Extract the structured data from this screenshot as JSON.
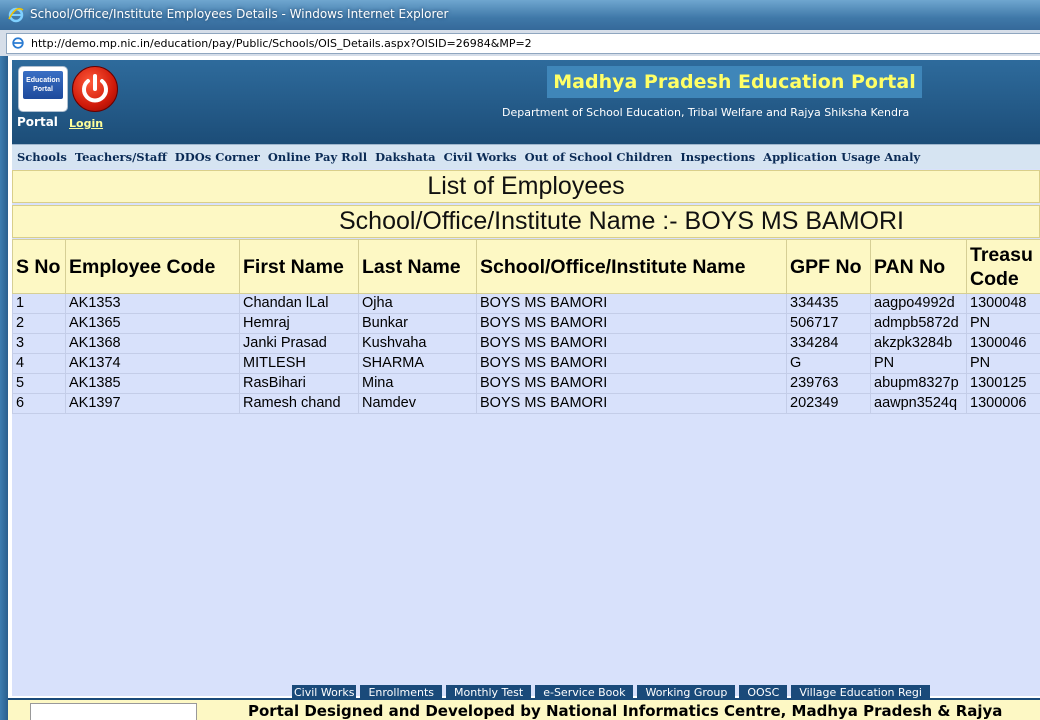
{
  "window": {
    "title": "School/Office/Institute Employees Details - Windows Internet Explorer",
    "url": "http://demo.mp.nic.in/education/pay/Public/Schools/OIS_Details.aspx?OISID=26984&MP=2"
  },
  "header": {
    "logo_text": "Education Portal",
    "portal_label": "Portal",
    "login_label": "Login",
    "site_title": "Madhya Pradesh Education Portal",
    "department": "Department of School Education, Tribal Welfare and Rajya Shiksha Kendra"
  },
  "nav": [
    "Schools",
    "Teachers/Staff",
    "DDOs Corner",
    "Online Pay Roll",
    "Dakshata",
    "Civil Works",
    "Out of School Children",
    "Inspections",
    "Application Usage Analy"
  ],
  "page": {
    "heading": "List of Employees",
    "school_line": "School/Office/Institute Name :- BOYS MS BAMORI"
  },
  "table": {
    "headers": [
      "S No",
      "Employee Code",
      "First Name",
      "Last Name",
      "School/Office/Institute Name",
      "GPF No",
      "PAN No",
      "Treasu Code"
    ],
    "rows": [
      [
        "1",
        "AK1353",
        "Chandan lLal",
        "Ojha",
        "BOYS MS BAMORI",
        "334435",
        "aagpo4992d",
        "1300048"
      ],
      [
        "2",
        "AK1365",
        "Hemraj",
        "Bunkar",
        "BOYS MS BAMORI",
        "506717",
        "admpb5872d",
        "PN"
      ],
      [
        "3",
        "AK1368",
        "Janki Prasad",
        "Kushvaha",
        "BOYS MS BAMORI",
        "334284",
        "akzpk3284b",
        "1300046"
      ],
      [
        "4",
        "AK1374",
        "MITLESH",
        "SHARMA",
        "BOYS MS BAMORI",
        "G",
        "PN",
        "PN"
      ],
      [
        "5",
        "AK1385",
        "RasBihari",
        "Mina",
        "BOYS MS BAMORI",
        "239763",
        "abupm8327p",
        "1300125"
      ],
      [
        "6",
        "AK1397",
        "Ramesh chand",
        "Namdev",
        "BOYS MS BAMORI",
        "202349",
        "aawpn3524q",
        "1300006"
      ]
    ]
  },
  "footer": {
    "links": [
      "Civil Works",
      "Enrollments",
      "Monthly Test",
      "e-Service Book",
      "Working Group",
      "OOSC",
      "Village Education Regi"
    ],
    "credit": "Portal Designed and Developed by National Informatics Centre, Madhya Pradesh & Rajya"
  }
}
